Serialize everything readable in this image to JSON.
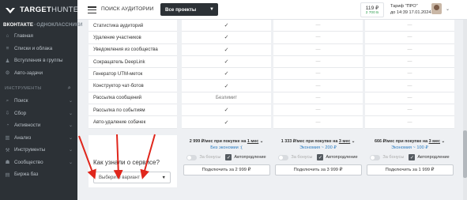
{
  "sidebar": {
    "logo_bold": "TARGET",
    "logo_thin": "HUNTER",
    "network_active": "ВКОНТАКТЕ",
    "network_inactive": "ОДНОКЛАССНИКИ",
    "items_top": [
      {
        "label": "Главная",
        "icon": "home-icon"
      },
      {
        "label": "Списки и облака",
        "icon": "list-icon"
      },
      {
        "label": "Вступления в группы",
        "icon": "users-icon"
      },
      {
        "label": "Авто-задачи",
        "icon": "robot-icon"
      }
    ],
    "tools_header": "ИНСТРУМЕНТЫ",
    "items_tools": [
      {
        "label": "Поиск",
        "icon": "search-icon"
      },
      {
        "label": "Сбор",
        "icon": "download-icon"
      },
      {
        "label": "Активности",
        "icon": "activity-icon"
      },
      {
        "label": "Анализ",
        "icon": "chart-icon"
      },
      {
        "label": "Инструменты",
        "icon": "tools-icon"
      },
      {
        "label": "Сообщество",
        "icon": "community-icon"
      },
      {
        "label": "Биржа баз",
        "icon": "database-icon"
      }
    ]
  },
  "topbar": {
    "page_title": "ПОИСК АУДИТОРИИ",
    "project_select": "Все проекты",
    "balance": "119 ₽",
    "balance_sub": "2 700 Б",
    "tariff_line1": "Тариф \"ПРО\"",
    "tariff_line2": "до 14:39 17.01.2024"
  },
  "features": [
    "Статистика аудиторий",
    "Удаление участников",
    "Уведомления из сообщества",
    "Сокращатель DeepLink",
    "Генератор UTM-меток",
    "Конструктор чат-ботов",
    "Рассылка сообщений",
    "Рассылка по событиям",
    "Авто-удаление собачек"
  ],
  "plans": [
    {
      "cells": [
        "check",
        "check",
        "check",
        "check",
        "check",
        "check",
        "Безлимит",
        "check",
        "check"
      ],
      "price_pre": "2 999 ₽/мес при покупке на ",
      "period": "1 мес",
      "saving": "Без экономии :(",
      "bonus_label": "За бонусы",
      "auto_label": "Автопродление",
      "button": "Подключить за 2 999 ₽"
    },
    {
      "cells": [
        "dash",
        "dash",
        "dash",
        "dash",
        "dash",
        "dash",
        "dash",
        "dash",
        "dash"
      ],
      "price_pre": "1 333 ₽/мес при покупке на ",
      "period": "3 мес",
      "saving": "Экономия ~ 200 ₽",
      "bonus_label": "За бонусы",
      "auto_label": "Автопродление",
      "button": "Подключить за 3 999 ₽"
    },
    {
      "cells": [
        "dash",
        "dash",
        "dash",
        "dash",
        "dash",
        "dash",
        "dash",
        "dash",
        "dash"
      ],
      "price_pre": "666 ₽/мес при покупке на ",
      "period": "3 мес",
      "saving": "Экономия ~ 100 ₽",
      "bonus_label": "За бонусы",
      "auto_label": "Автопродление",
      "button": "Подключить за 1 999 ₽"
    }
  ],
  "question": {
    "text": "Как узнали о сервисе?",
    "select_placeholder": "Выберите вариант"
  },
  "colors": {
    "sidebar_bg": "#2c3136",
    "accent_blue": "#2b7cc1",
    "arrow_red": "#e0261c"
  }
}
